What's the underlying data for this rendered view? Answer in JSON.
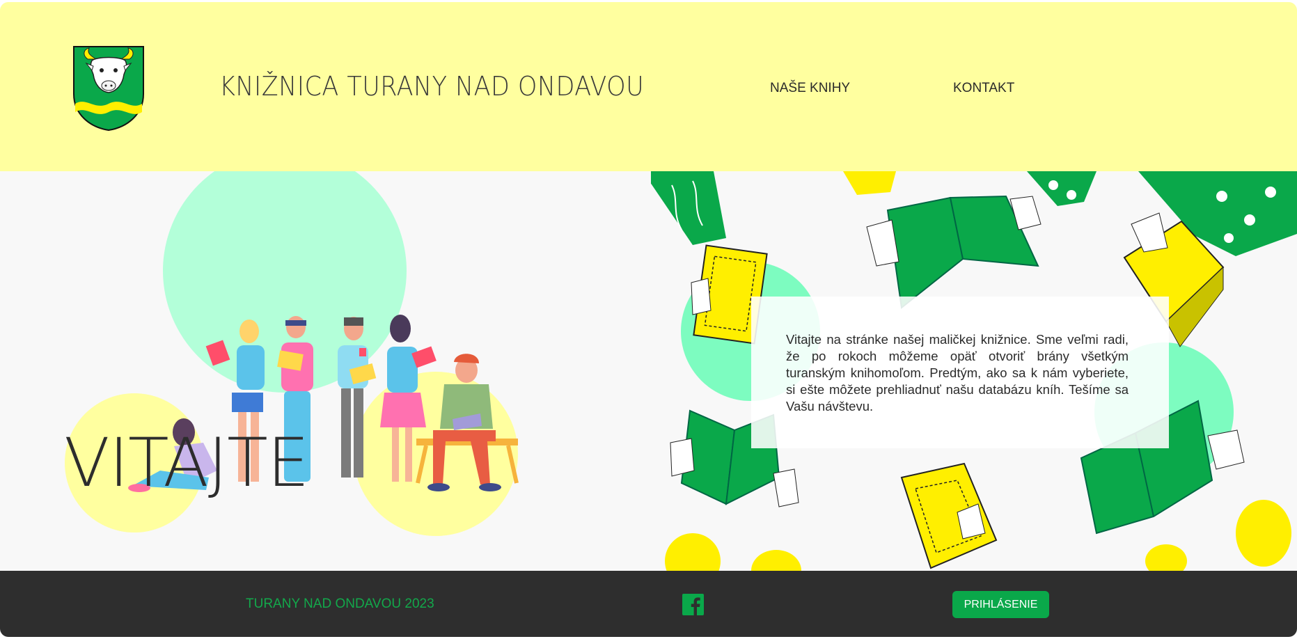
{
  "header": {
    "title": "KNIŽNICA TURANY NAD ONDAVOU",
    "nav": [
      {
        "label": "NAŠE KNIHY"
      },
      {
        "label": "KONTAKT"
      }
    ],
    "logo_icon": "coat-of-arms-bull-icon"
  },
  "hero": {
    "heading": "VITAJTE",
    "intro": "Vitajte na stránke našej maličkej knižnice. Sme veľmi radi, že po rokoch môžeme opäť otvoriť brány všetkým turanským knihomoľom. Predtým, ako sa k nám vyberiete, si ešte môžete prehliadnuť našu databázu kníh. Tešíme sa Vašu návštevu."
  },
  "footer": {
    "copyright": "TURANY NAD ONDAVOU 2023",
    "social_icon": "facebook-icon",
    "login_label": "PRIHLÁSENIE"
  },
  "colors": {
    "header_bg": "#ffff9f",
    "footer_bg": "#2e2e2e",
    "accent_green": "#0aa84a",
    "mint": "#b3ffd9",
    "pale_yellow": "#ffff9f"
  }
}
